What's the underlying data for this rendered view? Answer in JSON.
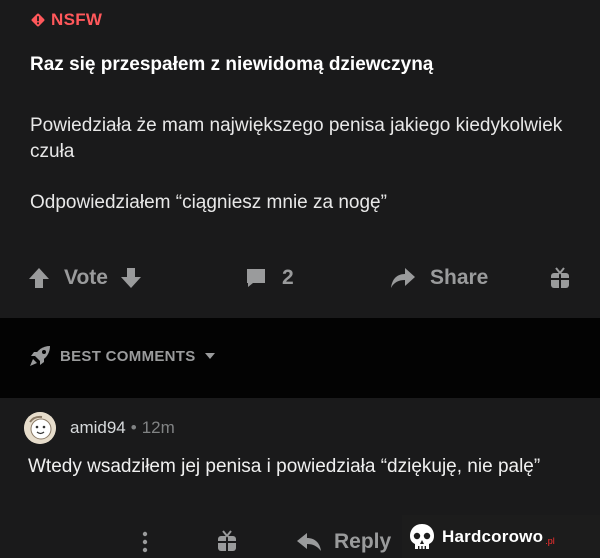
{
  "post": {
    "nsfw_label": "NSFW",
    "title": "Raz się przespałem z niewidomą dziewczyną",
    "body": [
      "Powiedziała że mam największego penisa jakiego kiedykolwiek czuła",
      "Odpowiedziałem “ciągniesz mnie za nogę”"
    ],
    "actions": {
      "vote_label": "Vote",
      "comment_count": "2",
      "share_label": "Share"
    }
  },
  "comments_section": {
    "sort_label": "BEST COMMENTS"
  },
  "comment": {
    "username": "amid94",
    "separator": "•",
    "age": "12m",
    "text": "Wtedy wsadziłem jej penisa i powiedziała “dziękuję, nie palę”",
    "reply_label": "Reply"
  },
  "watermark": {
    "brand": "Hardcorowo",
    "suffix": ".pl"
  },
  "colors": {
    "nsfw": "#ff585b",
    "background": "#1a1a1b",
    "band": "#030303",
    "muted": "#9a9b9c"
  }
}
